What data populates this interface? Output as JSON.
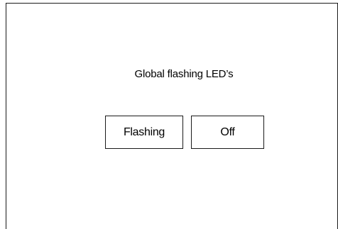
{
  "panel": {
    "title": "Global flashing LED’s"
  },
  "buttons": {
    "flashing_label": "Flashing",
    "off_label": "Off"
  }
}
